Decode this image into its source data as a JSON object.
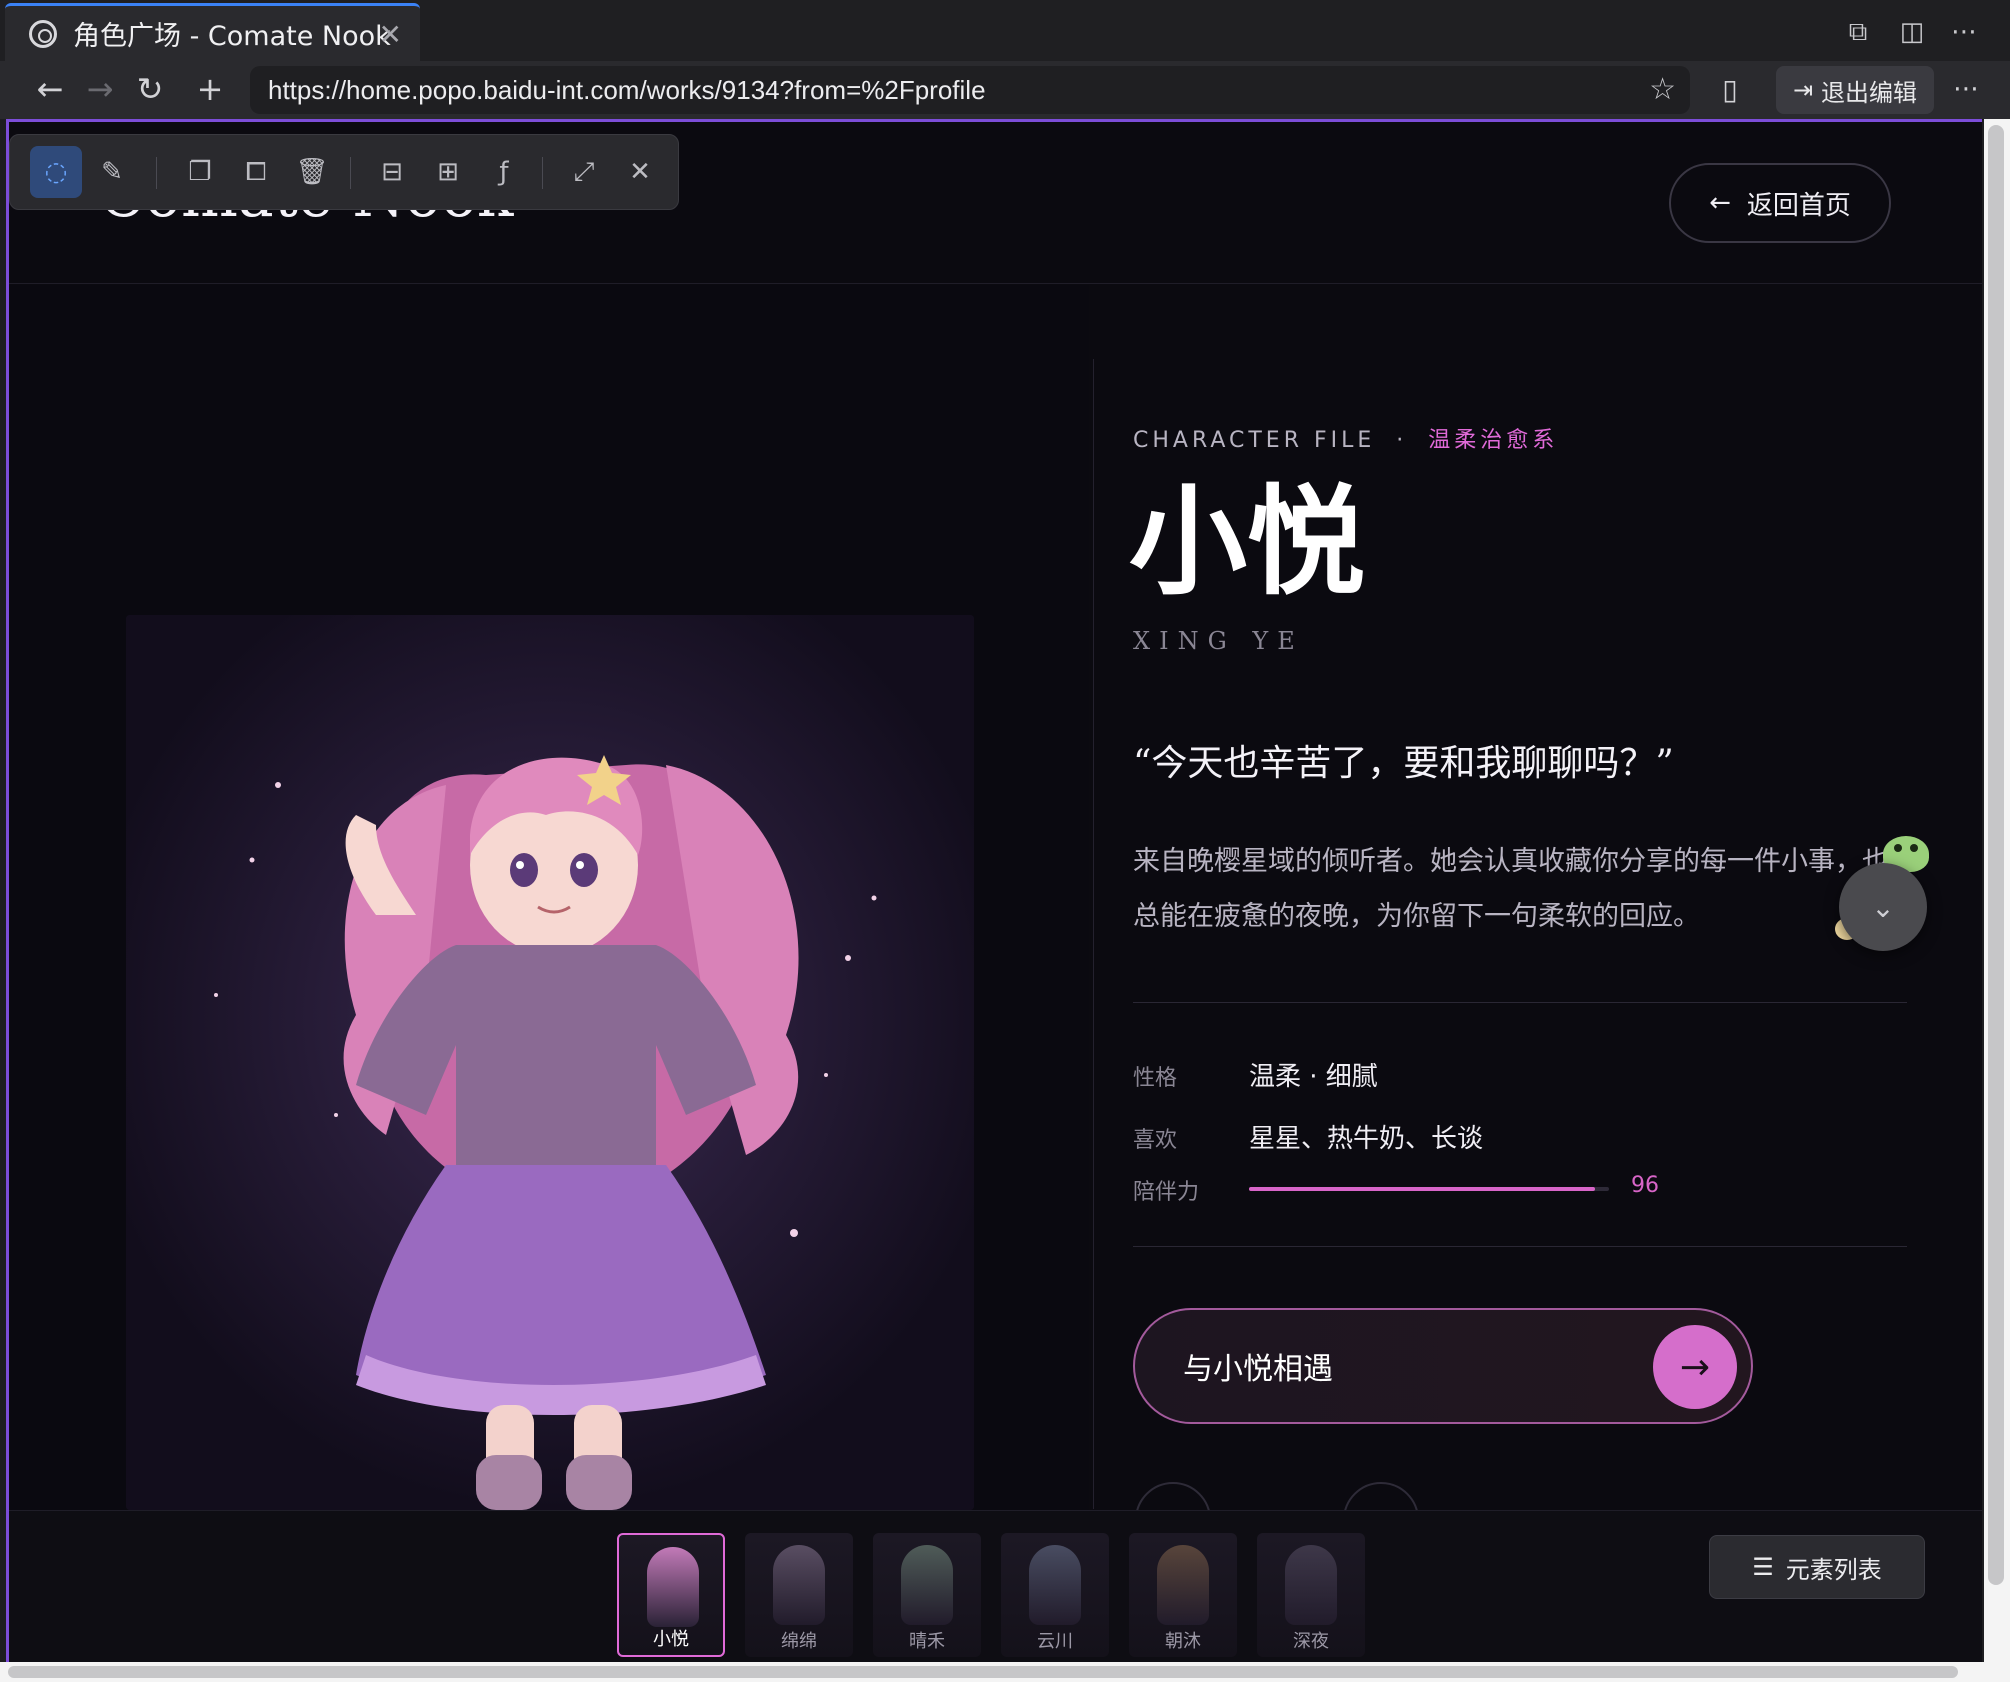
{
  "browser": {
    "tab_title": "角色广场 - Comate Nook",
    "url": "https://home.popo.baidu-int.com/works/9134?from=%2Fprofile",
    "exit_edit_label": "退出编辑"
  },
  "icons": {
    "tab_close": "✕",
    "new_window": "⧉",
    "split_view": "◫",
    "more": "⋯",
    "back": "←",
    "forward": "→",
    "reload": "↻",
    "new_tab": "+",
    "bookmark_star": "☆",
    "device": "▯",
    "exit": "⇥",
    "chevron_down": "⌄",
    "arrow_right": "→",
    "arrow_left": "←",
    "list": "☰"
  },
  "edit_toolbar": {
    "tools": [
      "select-tool",
      "edit-tool",
      "copy-tool",
      "duplicate-tool",
      "delete-tool",
      "layers-tool",
      "insert-tool",
      "figma-tool",
      "expand-tool",
      "close-tool"
    ],
    "glyphs": [
      "◌",
      "✎",
      "❐",
      "⧠",
      "🗑",
      "⊟",
      "⊞",
      "ƒ",
      "⤢",
      "✕"
    ]
  },
  "page": {
    "brand": "Comate Nook",
    "home_button": "返回首页"
  },
  "character": {
    "eyebrow": "CHARACTER FILE",
    "eyebrow_sep": "·",
    "tag": "温柔治愈系",
    "name": "小悦",
    "romaji": "XING YE",
    "quote": "“今天也辛苦了，要和我聊聊吗？”",
    "description": "来自晚樱星域的倾听者。她会认真收藏你分享的每一件小事，也总能在疲惫的夜晚，为你留下一句柔软的回应。",
    "attributes": [
      {
        "label": "性格",
        "value": "温柔 · 细腻"
      },
      {
        "label": "喜欢",
        "value": "星星、热牛奶、长谈"
      }
    ],
    "companionship": {
      "label": "陪伴力",
      "value": "96",
      "fraction": 0.96
    },
    "meet_button": "与小悦相遇"
  },
  "gallery": {
    "items": [
      {
        "name": "小悦",
        "active": true,
        "color": "#c27ab8"
      },
      {
        "name": "绵绵",
        "active": false,
        "color": "#8c7a96"
      },
      {
        "name": "晴禾",
        "active": false,
        "color": "#7a9484"
      },
      {
        "name": "云川",
        "active": false,
        "color": "#6e7894"
      },
      {
        "name": "朝沐",
        "active": false,
        "color": "#8a6a4e"
      },
      {
        "name": "深夜",
        "active": false,
        "color": "#5a5268"
      }
    ],
    "elements_button": "元素列表"
  },
  "colors": {
    "accent": "#e06ad8",
    "selection_border": "#7c4dd8",
    "tab_indicator": "#3b82f6"
  }
}
